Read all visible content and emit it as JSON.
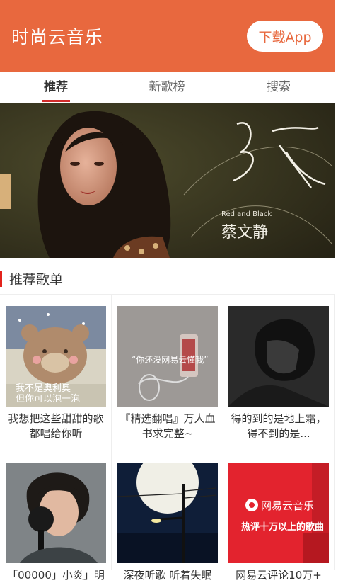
{
  "header": {
    "title": "时尚云音乐",
    "download_label": "下载App",
    "accent": "#e8683e"
  },
  "tabs": [
    {
      "label": "推荐",
      "active": true
    },
    {
      "label": "新歌榜",
      "active": false
    },
    {
      "label": "搜索",
      "active": false
    }
  ],
  "banner": {
    "subtitle": "Red and Black",
    "artist": "蔡文静"
  },
  "section": {
    "title": "推荐歌单"
  },
  "playlists": [
    {
      "title": "我想把这些甜甜的歌都唱给你听",
      "cover_text": "我不是奥利奥\n但你可以泡一泡"
    },
    {
      "title": "『精选翻唱』万人血书求完整~",
      "cover_text": "“你还没网易云懂我”"
    },
    {
      "title": "得的到的是地上霜，得不到的是...",
      "cover_text": ""
    },
    {
      "title": "「00000」小炎」明",
      "cover_text": ""
    },
    {
      "title": "深夜听歌 听着失眠",
      "cover_text": ""
    },
    {
      "title": "网易云评论10万+",
      "cover_text": "网易云音乐\n热评十万以上的歌曲"
    }
  ]
}
